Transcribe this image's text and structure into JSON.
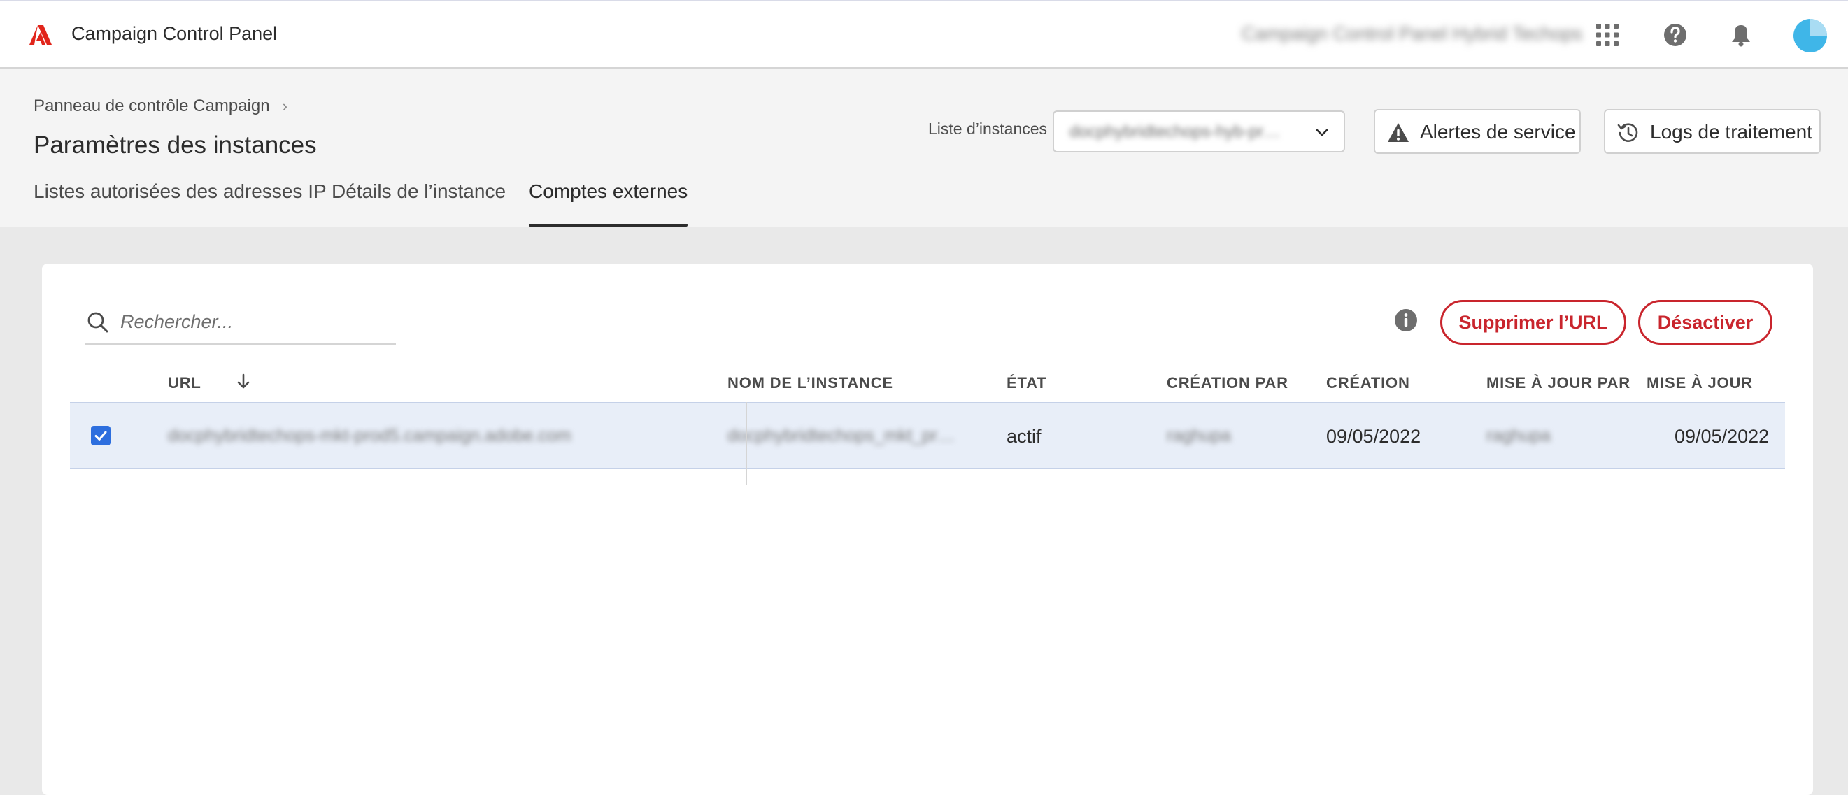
{
  "topbar": {
    "app_title": "Campaign Control Panel",
    "org_name": "Campaign Control Panel Hybrid Techops",
    "icons": [
      "adobe-logo-icon",
      "apps-grid-icon",
      "help-icon",
      "bell-icon",
      "avatar"
    ]
  },
  "header": {
    "breadcrumb": "Panneau de contrôle Campaign",
    "title": "Paramètres des instances",
    "instance_label": "Liste d’instances",
    "instance_value": "docphybridtechops-hyb-pr…",
    "alerts_button": "Alertes de service",
    "logs_button": "Logs de traitement"
  },
  "tabs": [
    {
      "label": "Listes autorisées des adresses IP",
      "active": false
    },
    {
      "label": "Détails de l’instance",
      "active": false
    },
    {
      "label": "Comptes externes",
      "active": true
    }
  ],
  "toolbar": {
    "search_placeholder": "Rechercher...",
    "delete_url_button": "Supprimer l’URL",
    "deactivate_button": "Désactiver"
  },
  "table": {
    "columns": [
      "URL",
      "NOM DE L’INSTANCE",
      "ÉTAT",
      "CRÉATION PAR",
      "CRÉATION",
      "MISE À JOUR PAR",
      "MISE À JOUR"
    ],
    "sort_column": "URL",
    "rows": [
      {
        "selected": true,
        "url": "docphybridtechops-mkt-prod5.campaign.adobe.com",
        "instance_name": "docphybridtechops_mkt_pr…",
        "state": "actif",
        "created_by": "raghupa",
        "created": "09/05/2022",
        "updated_by": "raghupa",
        "updated": "09/05/2022"
      }
    ]
  },
  "colors": {
    "accent_red": "#c9252d",
    "checkbox_blue": "#2d6ede",
    "selected_row": "#e8eef8"
  }
}
